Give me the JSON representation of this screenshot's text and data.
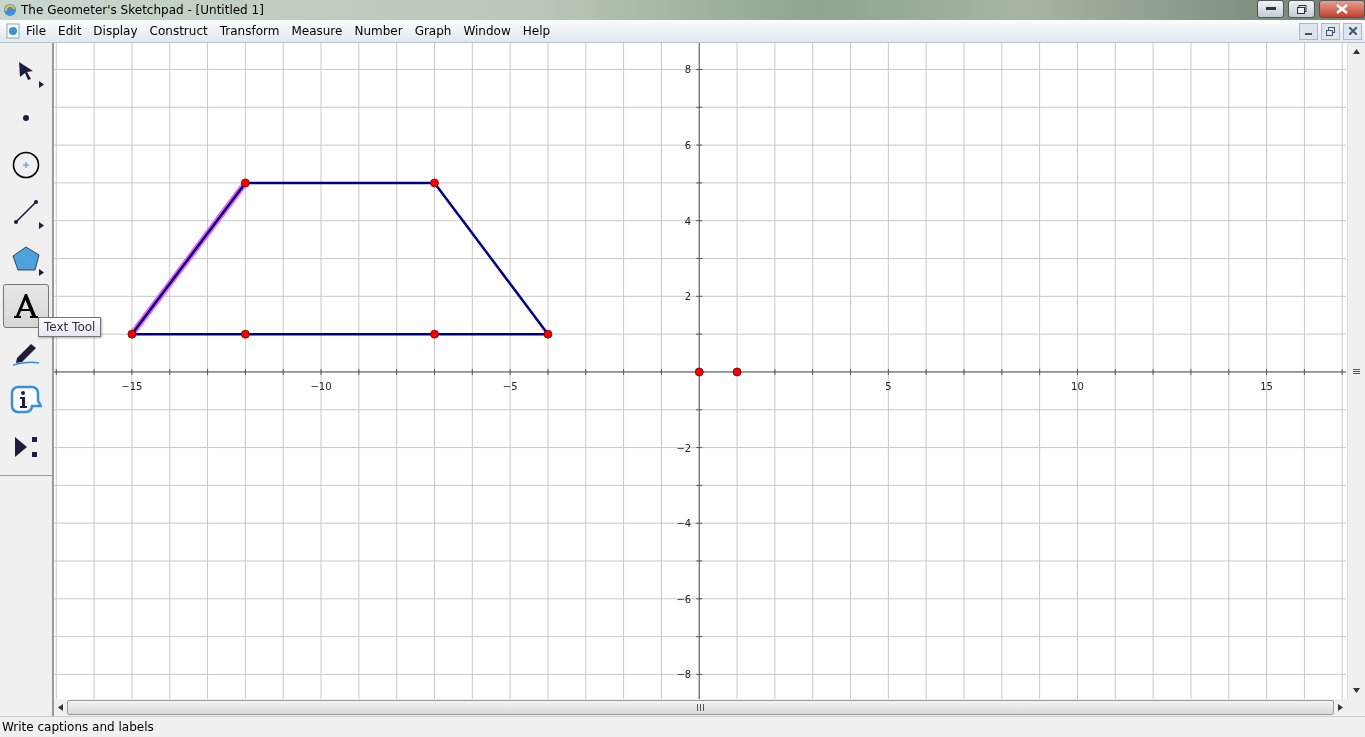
{
  "window": {
    "title": "The Geometer's Sketchpad - [Untitled 1]"
  },
  "menu": [
    "File",
    "Edit",
    "Display",
    "Construct",
    "Transform",
    "Measure",
    "Number",
    "Graph",
    "Window",
    "Help"
  ],
  "tools": [
    {
      "kind": "arrow",
      "selected": false,
      "has_menu": true
    },
    {
      "kind": "point",
      "selected": false,
      "has_menu": false
    },
    {
      "kind": "compass",
      "selected": false,
      "has_menu": false
    },
    {
      "kind": "straightedge",
      "selected": false,
      "has_menu": true
    },
    {
      "kind": "polygon",
      "selected": false,
      "has_menu": true
    },
    {
      "kind": "text",
      "selected": true,
      "has_menu": false
    },
    {
      "kind": "marker",
      "selected": false,
      "has_menu": false
    },
    {
      "kind": "information",
      "selected": false,
      "has_menu": false
    },
    {
      "kind": "custom",
      "selected": false,
      "has_menu": false
    }
  ],
  "tooltip": "Text Tool",
  "sketch": {
    "chart_data": {
      "type": "line",
      "grid": true,
      "xlim": [
        -17.06,
        17.1
      ],
      "ylim": [
        -8.65,
        8.7
      ],
      "xticks": [
        {
          "value": -15,
          "label": "−15"
        },
        {
          "value": -10,
          "label": "−10"
        },
        {
          "value": -5,
          "label": "−5"
        },
        {
          "value": 5,
          "label": "5"
        },
        {
          "value": 10,
          "label": "10"
        },
        {
          "value": 15,
          "label": "15"
        }
      ],
      "yticks": [
        {
          "value": -8,
          "label": "−8"
        },
        {
          "value": -6,
          "label": "−6"
        },
        {
          "value": -4,
          "label": "−4"
        },
        {
          "value": -2,
          "label": "−2"
        },
        {
          "value": 2,
          "label": "2"
        },
        {
          "value": 4,
          "label": "4"
        },
        {
          "value": 6,
          "label": "6"
        },
        {
          "value": 8,
          "label": "8"
        }
      ],
      "series": [
        {
          "color": "#ee66ee",
          "x": [
            -15,
            -12
          ],
          "values": [
            1,
            5
          ]
        },
        {
          "color": "#000080",
          "x": [
            -15,
            -12
          ],
          "values": [
            1,
            5
          ]
        },
        {
          "color": "#000080",
          "x": [
            -12,
            -7
          ],
          "values": [
            5,
            5
          ]
        },
        {
          "color": "#000080",
          "x": [
            -7,
            -4
          ],
          "values": [
            5,
            1
          ]
        },
        {
          "color": "#000080",
          "x": [
            -15,
            -12,
            -7,
            -4
          ],
          "values": [
            1,
            1,
            1,
            1
          ]
        },
        {
          "color": "#ff0000",
          "marker": "circle",
          "x": [
            -15
          ],
          "values": [
            1
          ]
        },
        {
          "color": "#ff0000",
          "marker": "circle",
          "x": [
            -12
          ],
          "values": [
            5
          ]
        },
        {
          "color": "#ff0000",
          "marker": "circle",
          "x": [
            -7
          ],
          "values": [
            5
          ]
        },
        {
          "color": "#ff0000",
          "marker": "circle",
          "x": [
            -4
          ],
          "values": [
            1
          ]
        },
        {
          "color": "#ff0000",
          "marker": "circle",
          "x": [
            -12
          ],
          "values": [
            1
          ]
        },
        {
          "color": "#ff0000",
          "marker": "circle",
          "x": [
            -7
          ],
          "values": [
            1
          ]
        },
        {
          "color": "#ff0000",
          "marker": "circle",
          "x": [
            0
          ],
          "values": [
            0
          ]
        },
        {
          "color": "#ff0000",
          "marker": "circle",
          "x": [
            1
          ],
          "values": [
            0
          ]
        }
      ]
    }
  },
  "status_bar": "Write captions and labels"
}
